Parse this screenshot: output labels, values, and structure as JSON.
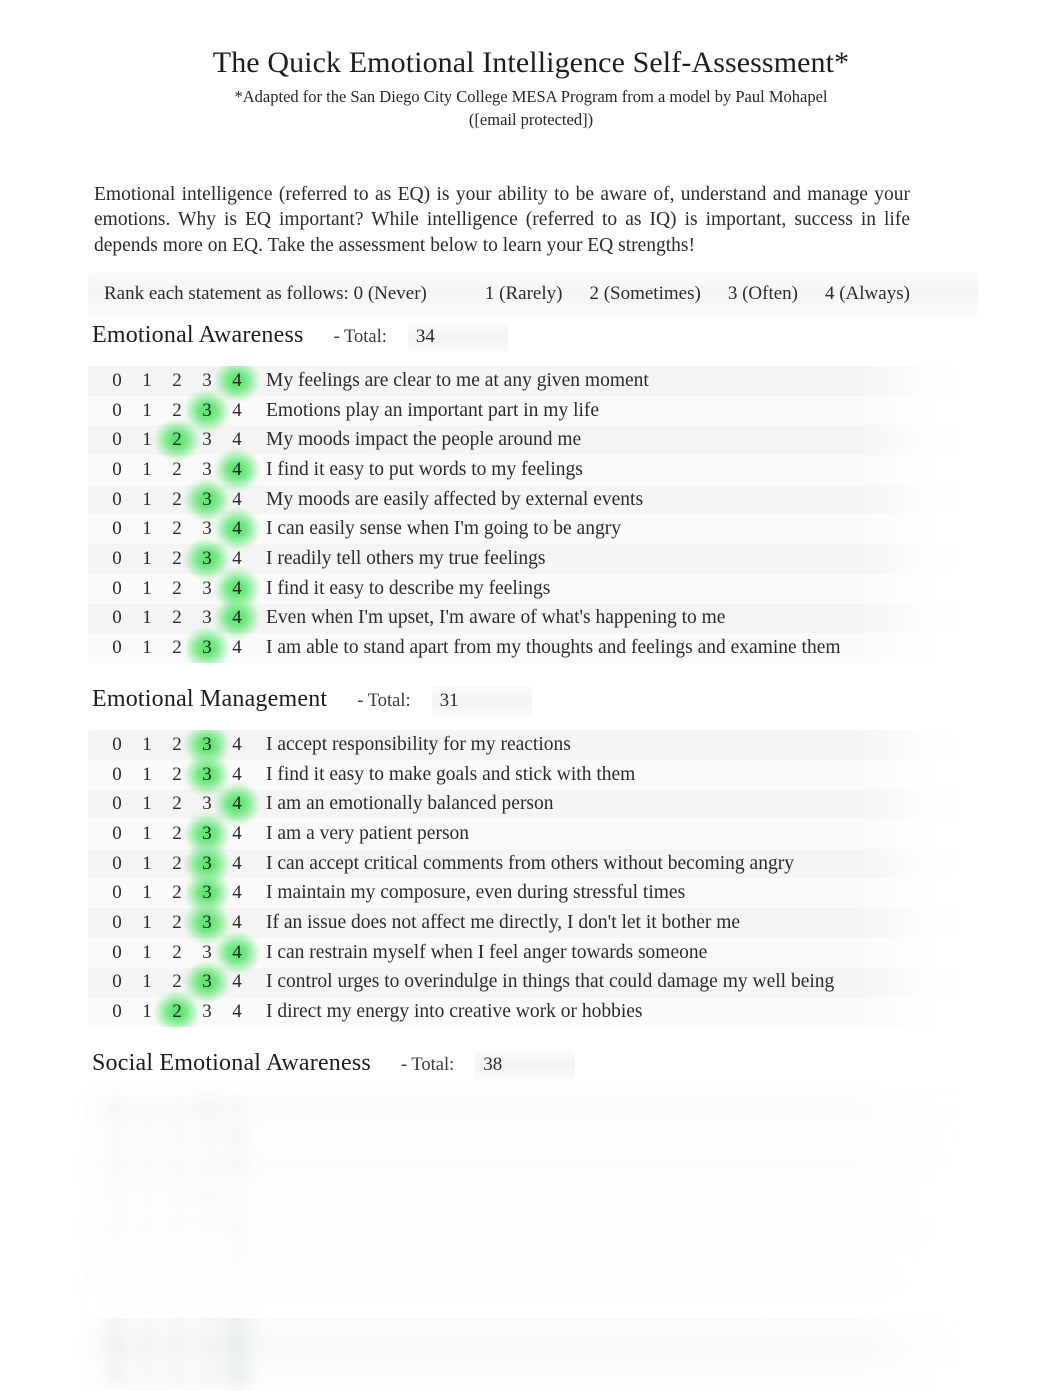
{
  "document": {
    "title": "The Quick Emotional Intelligence Self-Assessment*",
    "subtitle_line1": "*Adapted for the San Diego City College MESA Program from a model by Paul Mohapel",
    "subtitle_line2": "([email protected])",
    "intro": "Emotional intelligence (referred to as EQ) is your ability to be aware of, understand and manage your emotions. Why is EQ important? While intelligence (referred to as IQ) is important, success in life depends more on EQ. Take the assessment below to learn your EQ strengths!"
  },
  "rank_instruction": {
    "lead": "Rank each statement as follows: 0 (Never)",
    "options": [
      "1 (Rarely)",
      "2 (Sometimes)",
      "3 (Often)",
      "4 (Always)"
    ]
  },
  "scale_labels": [
    "0",
    "1",
    "2",
    "3",
    "4"
  ],
  "total_label": "- Total:",
  "accent_color": "#46e05c",
  "sections": [
    {
      "name": "Emotional Awareness",
      "total": "34",
      "blurred": false,
      "items": [
        {
          "text": "My feelings are clear to me at any given moment",
          "selected": 4
        },
        {
          "text": "Emotions play an important part in my life",
          "selected": 3
        },
        {
          "text": "My moods impact the people around me",
          "selected": 2
        },
        {
          "text": "I find it easy to put words to my feelings",
          "selected": 4
        },
        {
          "text": "My moods are easily affected by external events",
          "selected": 3
        },
        {
          "text": "I can easily sense when I'm going to be angry",
          "selected": 4
        },
        {
          "text": "I readily tell others my true feelings",
          "selected": 3
        },
        {
          "text": "I find it easy to describe my feelings",
          "selected": 4
        },
        {
          "text": "Even when I'm upset, I'm aware of what's happening to me",
          "selected": 4
        },
        {
          "text": "I am able to stand apart from my thoughts and feelings and examine them",
          "selected": 3
        }
      ]
    },
    {
      "name": "Emotional Management",
      "total": "31",
      "blurred": false,
      "items": [
        {
          "text": "I accept responsibility for my reactions",
          "selected": 3
        },
        {
          "text": "I find it easy to make goals and stick with them",
          "selected": 3
        },
        {
          "text": "I am an emotionally balanced person",
          "selected": 4
        },
        {
          "text": "I am a very patient person",
          "selected": 3
        },
        {
          "text": "I can accept critical comments from others without becoming angry",
          "selected": 3
        },
        {
          "text": "I maintain my composure, even during stressful times",
          "selected": 3
        },
        {
          "text": "If an issue does not affect me directly, I don't let it bother me",
          "selected": 3
        },
        {
          "text": "I can restrain myself when I feel anger towards someone",
          "selected": 4
        },
        {
          "text": "I control urges to overindulge in things that could damage my well being",
          "selected": 3
        },
        {
          "text": "I direct my energy into creative work or hobbies",
          "selected": 2
        }
      ]
    },
    {
      "name": "Social Emotional Awareness",
      "total": "38",
      "blurred": true,
      "items": [
        {
          "text": "",
          "selected": 3
        },
        {
          "text": "",
          "selected": 4
        },
        {
          "text": "",
          "selected": 4
        },
        {
          "text": "",
          "selected": 3
        },
        {
          "text": "",
          "selected": 4
        },
        {
          "text": "",
          "selected": 4
        },
        {
          "text": "",
          "selected": 4
        },
        {
          "text": "",
          "selected": 4
        },
        {
          "text": "",
          "selected": 4
        },
        {
          "text": "",
          "selected": 4
        }
      ]
    }
  ]
}
